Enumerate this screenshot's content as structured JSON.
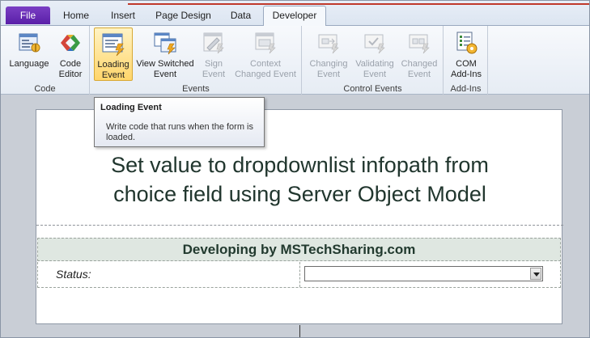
{
  "tabs": [
    {
      "label": "File"
    },
    {
      "label": "Home"
    },
    {
      "label": "Insert"
    },
    {
      "label": "Page Design"
    },
    {
      "label": "Data"
    },
    {
      "label": "Developer",
      "active": true
    }
  ],
  "ribbon": {
    "groups": [
      {
        "label": "Code",
        "buttons": [
          {
            "line1": "Language",
            "line2": "",
            "icon": "language-icon"
          },
          {
            "line1": "Code",
            "line2": "Editor",
            "icon": "code-editor-icon"
          }
        ]
      },
      {
        "label": "Events",
        "buttons": [
          {
            "line1": "Loading",
            "line2": "Event",
            "icon": "loading-event-icon",
            "selected": true
          },
          {
            "line1": "View Switched",
            "line2": "Event",
            "icon": "view-switched-icon"
          },
          {
            "line1": "Sign",
            "line2": "Event",
            "icon": "sign-event-icon",
            "disabled": true
          },
          {
            "line1": "Context",
            "line2": "Changed Event",
            "icon": "context-changed-icon",
            "disabled": true
          }
        ]
      },
      {
        "label": "Control Events",
        "buttons": [
          {
            "line1": "Changing",
            "line2": "Event",
            "icon": "changing-event-icon",
            "disabled": true
          },
          {
            "line1": "Validating",
            "line2": "Event",
            "icon": "validating-event-icon",
            "disabled": true
          },
          {
            "line1": "Changed",
            "line2": "Event",
            "icon": "changed-event-icon",
            "disabled": true
          }
        ]
      },
      {
        "label": "Add-Ins",
        "buttons": [
          {
            "line1": "COM",
            "line2": "Add-Ins",
            "icon": "com-addins-icon"
          }
        ]
      }
    ]
  },
  "tooltip": {
    "title": "Loading Event",
    "body": "Write code that runs when the form is loaded."
  },
  "form": {
    "title_line1": "Set value to dropdownlist infopath from",
    "title_line2": "choice field using Server Object Model",
    "banner": "Developing by MSTechSharing.com",
    "status_label": "Status:",
    "status_value": ""
  }
}
